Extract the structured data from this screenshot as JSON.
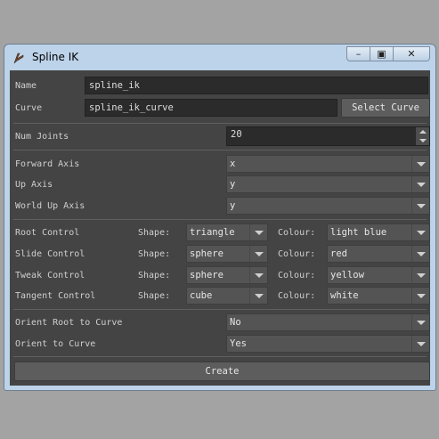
{
  "window": {
    "title": "Spline IK",
    "controls": {
      "minimize": "–",
      "maximize": "▣",
      "close": "✕"
    }
  },
  "name": {
    "label": "Name",
    "value": "spline_ik"
  },
  "curve": {
    "label": "Curve",
    "value": "spline_ik_curve",
    "button": "Select Curve"
  },
  "num_joints": {
    "label": "Num Joints",
    "value": "20"
  },
  "axes": {
    "forward": {
      "label": "Forward Axis",
      "value": "x"
    },
    "up": {
      "label": "Up Axis",
      "value": "y"
    },
    "world_up": {
      "label": "World Up Axis",
      "value": "y"
    }
  },
  "controls": [
    {
      "label": "Root Control",
      "shape_label": "Shape:",
      "shape": "triangle",
      "colour_label": "Colour:",
      "colour": "light blue"
    },
    {
      "label": "Slide Control",
      "shape_label": "Shape:",
      "shape": "sphere",
      "colour_label": "Colour:",
      "colour": "red"
    },
    {
      "label": "Tweak Control",
      "shape_label": "Shape:",
      "shape": "sphere",
      "colour_label": "Colour:",
      "colour": "yellow"
    },
    {
      "label": "Tangent Control",
      "shape_label": "Shape:",
      "shape": "cube",
      "colour_label": "Colour:",
      "colour": "white"
    }
  ],
  "orient": {
    "root": {
      "label": "Orient Root to Curve",
      "value": "No"
    },
    "curve": {
      "label": "Orient to Curve",
      "value": "Yes"
    }
  },
  "create_button": "Create"
}
